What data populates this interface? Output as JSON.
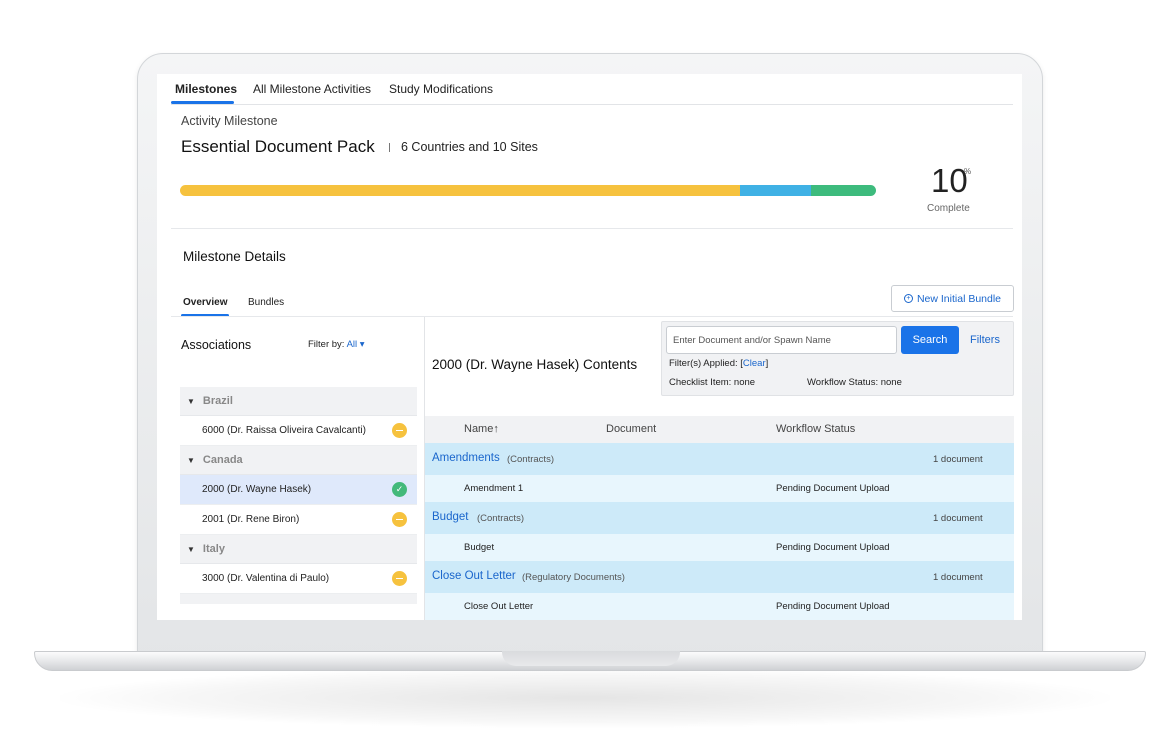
{
  "top_tabs": [
    {
      "label": "Milestones",
      "active": true
    },
    {
      "label": "All Milestone Activities",
      "active": false
    },
    {
      "label": "Study Modifications",
      "active": false
    }
  ],
  "header": {
    "crumb": "Activity Milestone",
    "title": "Essential Document Pack",
    "subtitle": "6 Countries and 10 Sites",
    "percent": "10",
    "percent_sign": "%",
    "percent_label": "Complete",
    "progress": {
      "yellow": 80.5,
      "blue": 10.2,
      "green": 9.3
    }
  },
  "details": {
    "title": "Milestone Details",
    "tabs": [
      {
        "label": "Overview",
        "active": true
      },
      {
        "label": "Bundles",
        "active": false
      }
    ],
    "new_bundle_label": "New Initial Bundle"
  },
  "associations": {
    "title": "Associations",
    "filter_label": "Filter by:",
    "filter_value": "All",
    "groups": [
      {
        "country": "Brazil",
        "sites": [
          {
            "name": "6000 (Dr. Raissa Oliveira Cavalcanti)",
            "status": "pending"
          }
        ]
      },
      {
        "country": "Canada",
        "sites": [
          {
            "name": "2000 (Dr. Wayne Hasek)",
            "status": "done",
            "selected": true
          },
          {
            "name": "2001 (Dr. Rene Biron)",
            "status": "pending"
          }
        ]
      },
      {
        "country": "Italy",
        "sites": [
          {
            "name": "3000 (Dr. Valentina di Paulo)",
            "status": "pending"
          }
        ]
      }
    ]
  },
  "contents": {
    "title": "2000 (Dr. Wayne Hasek) Contents",
    "search": {
      "placeholder": "Enter Document and/or Spawn Name",
      "button": "Search",
      "filters_link": "Filters",
      "applied_label": "Filter(s) Applied: [",
      "clear_label": "Clear",
      "applied_close": "]",
      "checklist": "Checklist Item: none",
      "workflow": "Workflow Status: none"
    },
    "columns": {
      "name": "Name",
      "sort_icon": "↑",
      "document": "Document",
      "status": "Workflow Status"
    },
    "groups": [
      {
        "name": "Amendments",
        "category": "(Contracts)",
        "count": "1 document",
        "item": "Amendment 1",
        "status": "Pending Document Upload"
      },
      {
        "name": "Budget",
        "category": "(Contracts)",
        "count": "1 document",
        "item": "Budget",
        "status": "Pending Document Upload"
      },
      {
        "name": "Close Out Letter",
        "category": "(Regulatory Documents)",
        "count": "1 document",
        "item": "Close Out Letter",
        "status": "Pending Document Upload"
      }
    ]
  },
  "colors": {
    "accent": "#1a73e8",
    "progress_yellow": "#f6c23e",
    "progress_blue": "#3fb1e5",
    "progress_green": "#3dbb7d"
  }
}
